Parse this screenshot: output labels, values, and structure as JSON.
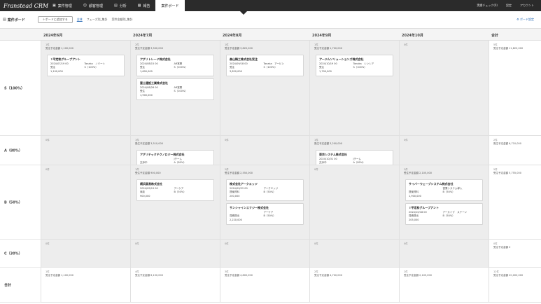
{
  "app": {
    "logo": "Franstead CRM",
    "nav": [
      {
        "icon": "building-icon",
        "glyph": "▣",
        "label": "案件管理",
        "active": false
      },
      {
        "icon": "person-icon",
        "glyph": "☺",
        "label": "顧客管理",
        "active": false
      },
      {
        "icon": "chart-icon",
        "glyph": "▤",
        "label": "分析",
        "active": false
      },
      {
        "icon": "calendar-icon",
        "glyph": "▦",
        "label": "報告",
        "active": false
      },
      {
        "icon": "",
        "glyph": "",
        "label": "案件ボード",
        "active": true
      }
    ],
    "right_links": [
      "実績チェック(0)",
      "設定",
      "アカウント"
    ]
  },
  "toolbar": {
    "title": "案件ボード",
    "add_button": "＋ボードに追加する",
    "filters": [
      "全体",
      "フェーズ別_集計",
      "案件金額別_集計"
    ],
    "active_filter": 0,
    "settings": "ボード設定"
  },
  "board": {
    "columns": [
      "2024年6月",
      "2024年7月",
      "2024年8月",
      "2024年9月",
      "2024年10月",
      "合計"
    ],
    "rows": [
      {
        "label": "S（100%）",
        "cells": [
          {
            "count": "1件",
            "sum": "受注予定金額",
            "amount": "1,100,000",
            "cards": [
              {
                "name": "⇧平定和グループアント",
                "lines": [
                  [
                    "2024/07/19 00",
                    "Tanaka　ノバート"
                  ],
                  [
                    "受注",
                    "S（100%）"
                  ]
                ],
                "amount": "1,100,000"
              }
            ]
          },
          {
            "count": "2件",
            "sum": "受注予定金額",
            "amount": "3,500,000",
            "cards": [
              {
                "name": "アグリトレード株式会社",
                "lines": [
                  [
                    "2024/08/15 00",
                    "AR営業"
                  ],
                  [
                    "受注",
                    "S（100%）"
                  ]
                ],
                "amount": "1,600,000"
              },
              {
                "name": "富士建設工業株式会社",
                "lines": [
                  [
                    "2024/08/26 00",
                    "AR営業"
                  ],
                  [
                    "受注",
                    "S（100%）"
                  ]
                ],
                "amount": "1,900,000"
              }
            ]
          },
          {
            "count": "1件",
            "sum": "受注予定金額",
            "amount": "3,820,000",
            "cards": [
              {
                "name": "森山精工株式会社受注",
                "lines": [
                  [
                    "2024/09/18 00",
                    "Tanaka　アービン"
                  ],
                  [
                    "受注",
                    "S（100%）"
                  ]
                ],
                "amount": "3,820,000"
              }
            ]
          },
          {
            "count": "1件",
            "sum": "受注予定金額",
            "amount": "1,700,000",
            "cards": [
              {
                "name": "アージムソリューションズ株式会社",
                "lines": [
                  [
                    "2024/10/19 00",
                    "Tanaka　シンシア"
                  ],
                  [
                    "受注",
                    "S（100%）"
                  ]
                ],
                "amount": "1,700,000"
              }
            ]
          },
          {
            "count": "0件",
            "sum": "",
            "amount": "",
            "cards": []
          },
          {
            "count": "5件",
            "sum": "受注予定金額",
            "amount": "11,820,000",
            "cards": []
          }
        ]
      },
      {
        "label": "A（80%）",
        "cells": [
          {
            "count": "0件",
            "sum": "",
            "amount": "",
            "cards": []
          },
          {
            "count": "1件",
            "sum": "受注予定金額",
            "amount": "3,510,000",
            "cards": [
              {
                "name": "アグリテックテクノロジー株式会社",
                "lines": [
                  [
                    "",
                    "Jチーム"
                  ],
                  [
                    "交渉中",
                    "A（80%）"
                  ]
                ],
                "amount": "3,800,000"
              }
            ]
          },
          {
            "count": "0件",
            "sum": "",
            "amount": "",
            "cards": []
          },
          {
            "count": "1件",
            "sum": "受注予定金額",
            "amount": "3,200,000",
            "cards": [
              {
                "name": "東京システム株式会社",
                "lines": [
                  [
                    "2024/10/31 00",
                    "Jチーム"
                  ],
                  [
                    "交渉中",
                    "A（80%）"
                  ]
                ],
                "amount": "3,200,000"
              }
            ]
          },
          {
            "count": "0件",
            "sum": "",
            "amount": "",
            "cards": []
          },
          {
            "count": "2件",
            "sum": "受注予定金額",
            "amount": "6,710,000",
            "cards": []
          }
        ]
      },
      {
        "label": "B（50%）",
        "cells": [
          {
            "count": "0件",
            "sum": "",
            "amount": "",
            "cards": []
          },
          {
            "count": "1件",
            "sum": "受注予定金額",
            "amount": "900,000",
            "cards": [
              {
                "name": "横浜貿易株式会社",
                "lines": [
                  [
                    "2024/09/19 00",
                    "アーケア"
                  ],
                  [
                    "商談",
                    "B（50%）"
                  ]
                ],
                "amount": "900,000"
              }
            ]
          },
          {
            "count": "2件",
            "sum": "受注予定金額",
            "amount": "2,550,000",
            "cards": [
              {
                "name": "株式会社アークエッジ",
                "lines": [
                  [
                    "2024/09/22 00",
                    "アークエッジ"
                  ],
                  [
                    "提案資料",
                    "B（50%）"
                  ]
                ],
                "amount": "200,000"
              },
              {
                "name": "サンシャインエナジー株式会社",
                "lines": [
                  [
                    "",
                    "アーケア"
                  ],
                  [
                    "見積提出",
                    "B（50%）"
                  ]
                ],
                "amount": "2,220,000"
              }
            ]
          },
          {
            "count": "0件",
            "sum": "",
            "amount": "",
            "cards": []
          },
          {
            "count": "2件",
            "sum": "受注予定金額",
            "amount": "2,105,000",
            "cards": [
              {
                "name": "サイバーウェーブシステム株式会社",
                "lines": [
                  [
                    "",
                    "営業システム導入"
                  ],
                  [
                    "提案資料",
                    "B（50%）"
                  ]
                ],
                "amount": "1,900,000"
              },
              {
                "name": "⇧平定和グループアント",
                "lines": [
                  [
                    "2024/10/18 00",
                    "アーカイブ　ステーン"
                  ],
                  [
                    "見積提出",
                    "B（50%）"
                  ]
                ],
                "amount": "205,000"
              }
            ]
          },
          {
            "count": "5件",
            "sum": "受注予定金額",
            "amount": "5,755,000",
            "cards": []
          }
        ]
      },
      {
        "label": "C（30%）",
        "cells": [
          {
            "count": "0件",
            "sum": "",
            "amount": "",
            "cards": []
          },
          {
            "count": "0件",
            "sum": "",
            "amount": "",
            "cards": []
          },
          {
            "count": "0件",
            "sum": "",
            "amount": "",
            "cards": []
          },
          {
            "count": "0件",
            "sum": "",
            "amount": "",
            "cards": []
          },
          {
            "count": "0件",
            "sum": "",
            "amount": "",
            "cards": []
          },
          {
            "count": "0件",
            "sum": "受注予定金額",
            "amount": "0",
            "cards": []
          }
        ]
      },
      {
        "label": "合計",
        "cells": [
          {
            "count": "1件",
            "sum": "受注予定金額",
            "amount": "1,100,000",
            "cards": []
          },
          {
            "count": "4件",
            "sum": "受注予定金額",
            "amount": "6,150,000",
            "cards": []
          },
          {
            "count": "3件",
            "sum": "受注予定金額",
            "amount": "4,800,000",
            "cards": []
          },
          {
            "count": "2件",
            "sum": "受注予定金額",
            "amount": "4,700,000",
            "cards": []
          },
          {
            "count": "2件",
            "sum": "受注予定金額",
            "amount": "2,105,000",
            "cards": []
          },
          {
            "count": "12件",
            "sum": "受注予定金額",
            "amount": "20,000,000",
            "cards": []
          }
        ]
      }
    ]
  }
}
